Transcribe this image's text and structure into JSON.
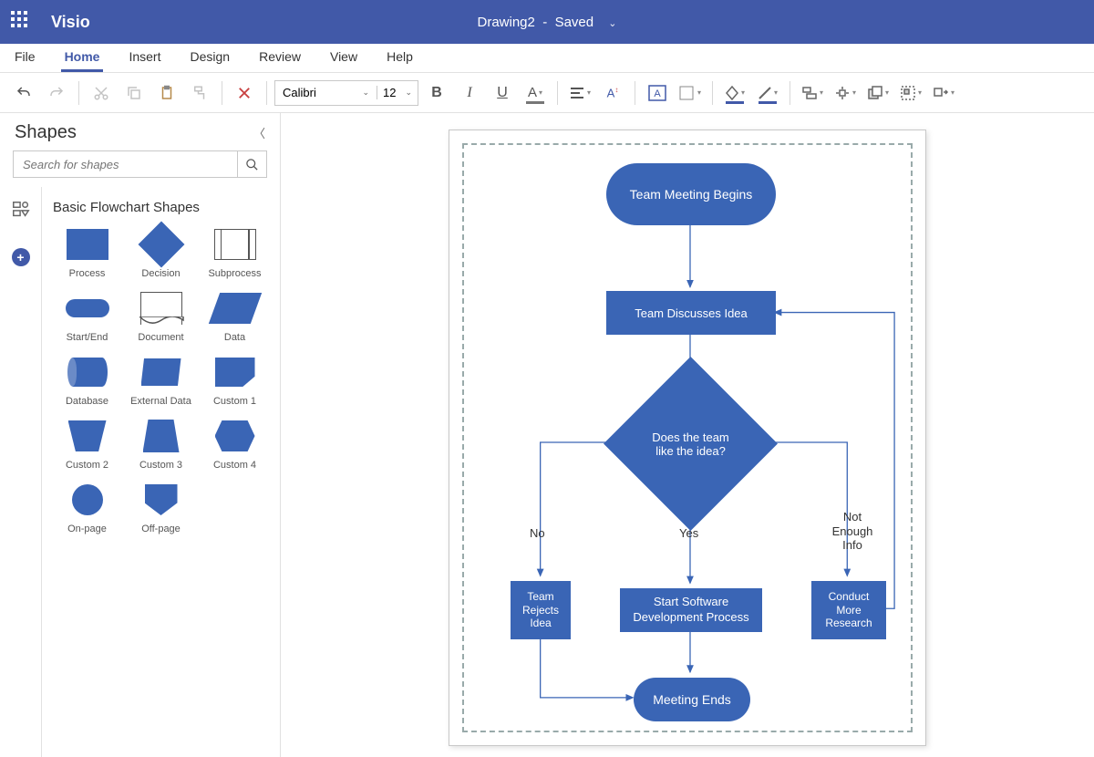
{
  "app": {
    "name": "Visio"
  },
  "document": {
    "name": "Drawing2",
    "status": "Saved"
  },
  "tabs": [
    "File",
    "Home",
    "Insert",
    "Design",
    "Review",
    "View",
    "Help"
  ],
  "active_tab": 1,
  "toolbar": {
    "font_name": "Calibri",
    "font_size": "12"
  },
  "shapes_panel": {
    "title": "Shapes",
    "search_placeholder": "Search for shapes",
    "category": "Basic Flowchart Shapes",
    "shapes": [
      "Process",
      "Decision",
      "Subprocess",
      "Start/End",
      "Document",
      "Data",
      "Database",
      "External Data",
      "Custom 1",
      "Custom 2",
      "Custom 3",
      "Custom 4",
      "On-page",
      "Off-page"
    ]
  },
  "flowchart": {
    "nodes": {
      "start": "Team Meeting Begins",
      "discuss": "Team Discusses Idea",
      "decision": "Does the team like the idea?",
      "reject": "Team Rejects Idea",
      "dev": "Start Software Development Process",
      "research": "Conduct More Research",
      "end": "Meeting Ends"
    },
    "edge_labels": {
      "no": "No",
      "yes": "Yes",
      "info": "Not Enough Info"
    }
  },
  "colors": {
    "brand": "#4159a8",
    "shape": "#3a65b5"
  }
}
